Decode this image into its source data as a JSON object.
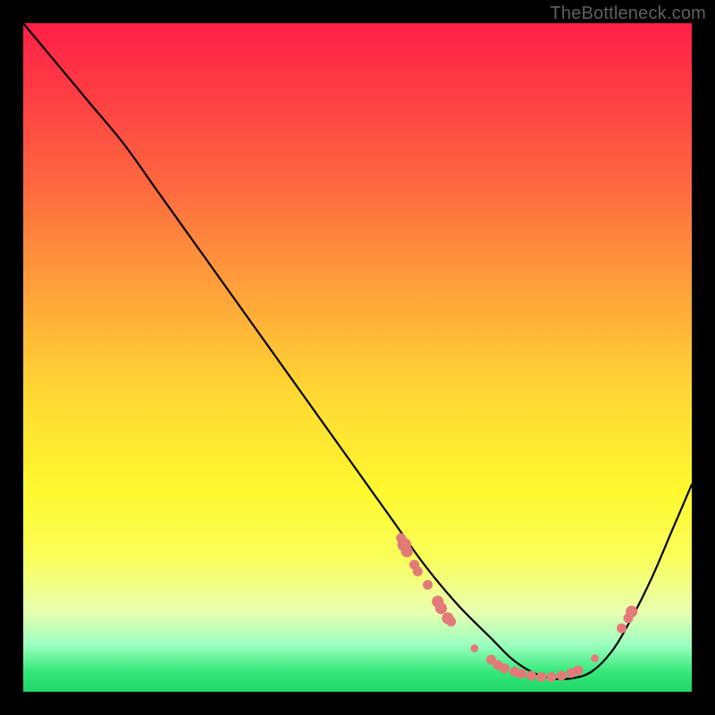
{
  "watermark": "TheBottleneck.com",
  "colors": {
    "dot": "#e47a78",
    "curve": "#000000"
  },
  "chart_data": {
    "type": "line",
    "title": "",
    "xlabel": "",
    "ylabel": "",
    "xlim": [
      0,
      100
    ],
    "ylim": [
      0,
      100
    ],
    "grid": false,
    "series": [
      {
        "name": "bottleneck-curve",
        "x": [
          0,
          5,
          10,
          15,
          20,
          25,
          30,
          35,
          40,
          45,
          50,
          55,
          60,
          65,
          70,
          73,
          76,
          79,
          82,
          85,
          88,
          91,
          94,
          97,
          100
        ],
        "values": [
          100,
          94,
          88,
          82,
          75,
          68,
          61,
          54,
          47,
          40,
          33,
          26,
          19,
          13,
          8,
          5,
          3,
          2,
          2,
          3,
          6,
          11,
          17,
          24,
          31
        ]
      }
    ],
    "markers": [
      {
        "x": 56.5,
        "y": 23.0,
        "r": 1.0
      },
      {
        "x": 57.0,
        "y": 22.0,
        "r": 1.4
      },
      {
        "x": 57.4,
        "y": 21.0,
        "r": 1.2
      },
      {
        "x": 58.5,
        "y": 19.0,
        "r": 1.0
      },
      {
        "x": 59.0,
        "y": 18.0,
        "r": 1.0
      },
      {
        "x": 60.5,
        "y": 16.0,
        "r": 1.0
      },
      {
        "x": 62.0,
        "y": 13.5,
        "r": 1.2
      },
      {
        "x": 62.5,
        "y": 12.5,
        "r": 1.2
      },
      {
        "x": 63.5,
        "y": 11.0,
        "r": 1.2
      },
      {
        "x": 64.0,
        "y": 10.5,
        "r": 1.0
      },
      {
        "x": 67.5,
        "y": 6.5,
        "r": 0.8
      },
      {
        "x": 70.0,
        "y": 4.8,
        "r": 1.0
      },
      {
        "x": 71.0,
        "y": 4.0,
        "r": 1.0
      },
      {
        "x": 72.0,
        "y": 3.5,
        "r": 1.0
      },
      {
        "x": 73.5,
        "y": 3.0,
        "r": 1.0
      },
      {
        "x": 74.5,
        "y": 2.7,
        "r": 1.0
      },
      {
        "x": 76.0,
        "y": 2.4,
        "r": 1.0
      },
      {
        "x": 77.5,
        "y": 2.2,
        "r": 1.0
      },
      {
        "x": 79.0,
        "y": 2.2,
        "r": 1.0
      },
      {
        "x": 80.5,
        "y": 2.4,
        "r": 1.0
      },
      {
        "x": 82.0,
        "y": 2.8,
        "r": 1.0
      },
      {
        "x": 83.0,
        "y": 3.2,
        "r": 1.0
      },
      {
        "x": 85.5,
        "y": 5.0,
        "r": 0.8
      },
      {
        "x": 89.5,
        "y": 9.5,
        "r": 1.0
      },
      {
        "x": 90.5,
        "y": 11.0,
        "r": 1.0
      },
      {
        "x": 91.0,
        "y": 12.0,
        "r": 1.2
      }
    ]
  }
}
